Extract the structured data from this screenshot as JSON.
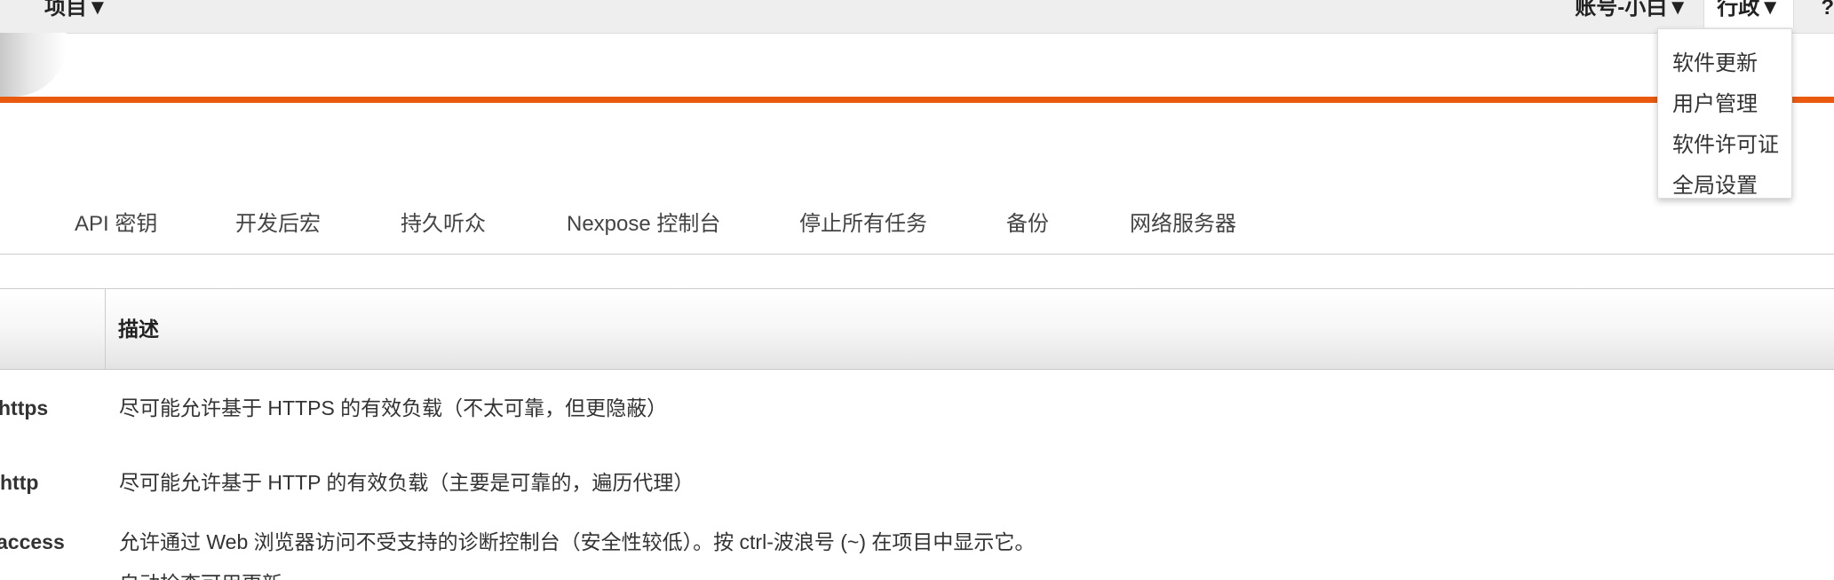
{
  "nav": {
    "projects": "项目▼",
    "account": "账号-小白▼",
    "admin": "行政▼",
    "help": "?"
  },
  "admin_menu": [
    {
      "label": "软件更新"
    },
    {
      "label": "用户管理"
    },
    {
      "label": "软件许可证"
    },
    {
      "label": "全局设置"
    }
  ],
  "tabs": [
    {
      "label": "API 密钥"
    },
    {
      "label": "开发后宏"
    },
    {
      "label": "持久听众"
    },
    {
      "label": "Nexpose 控制台"
    },
    {
      "label": "停止所有任务"
    },
    {
      "label": "备份"
    },
    {
      "label": "网络服务器"
    }
  ],
  "table": {
    "header_description": "描述",
    "rows": [
      {
        "name": "https",
        "description": "尽可能允许基于 HTTPS 的有效负载（不太可靠，但更隐蔽）"
      },
      {
        "name": "http",
        "description": "尽可能允许基于 HTTP 的有效负载（主要是可靠的，遍历代理）"
      },
      {
        "name": "access",
        "description": "允许通过 Web 浏览器访问不受支持的诊断控制台（安全性较低）。按 ctrl-波浪号 (~) 在项目中显示它。"
      },
      {
        "name": "",
        "description": "自动检查可用更新"
      }
    ]
  },
  "colors": {
    "accent": "#e95a0f",
    "nav_bg": "#eeeeee"
  }
}
